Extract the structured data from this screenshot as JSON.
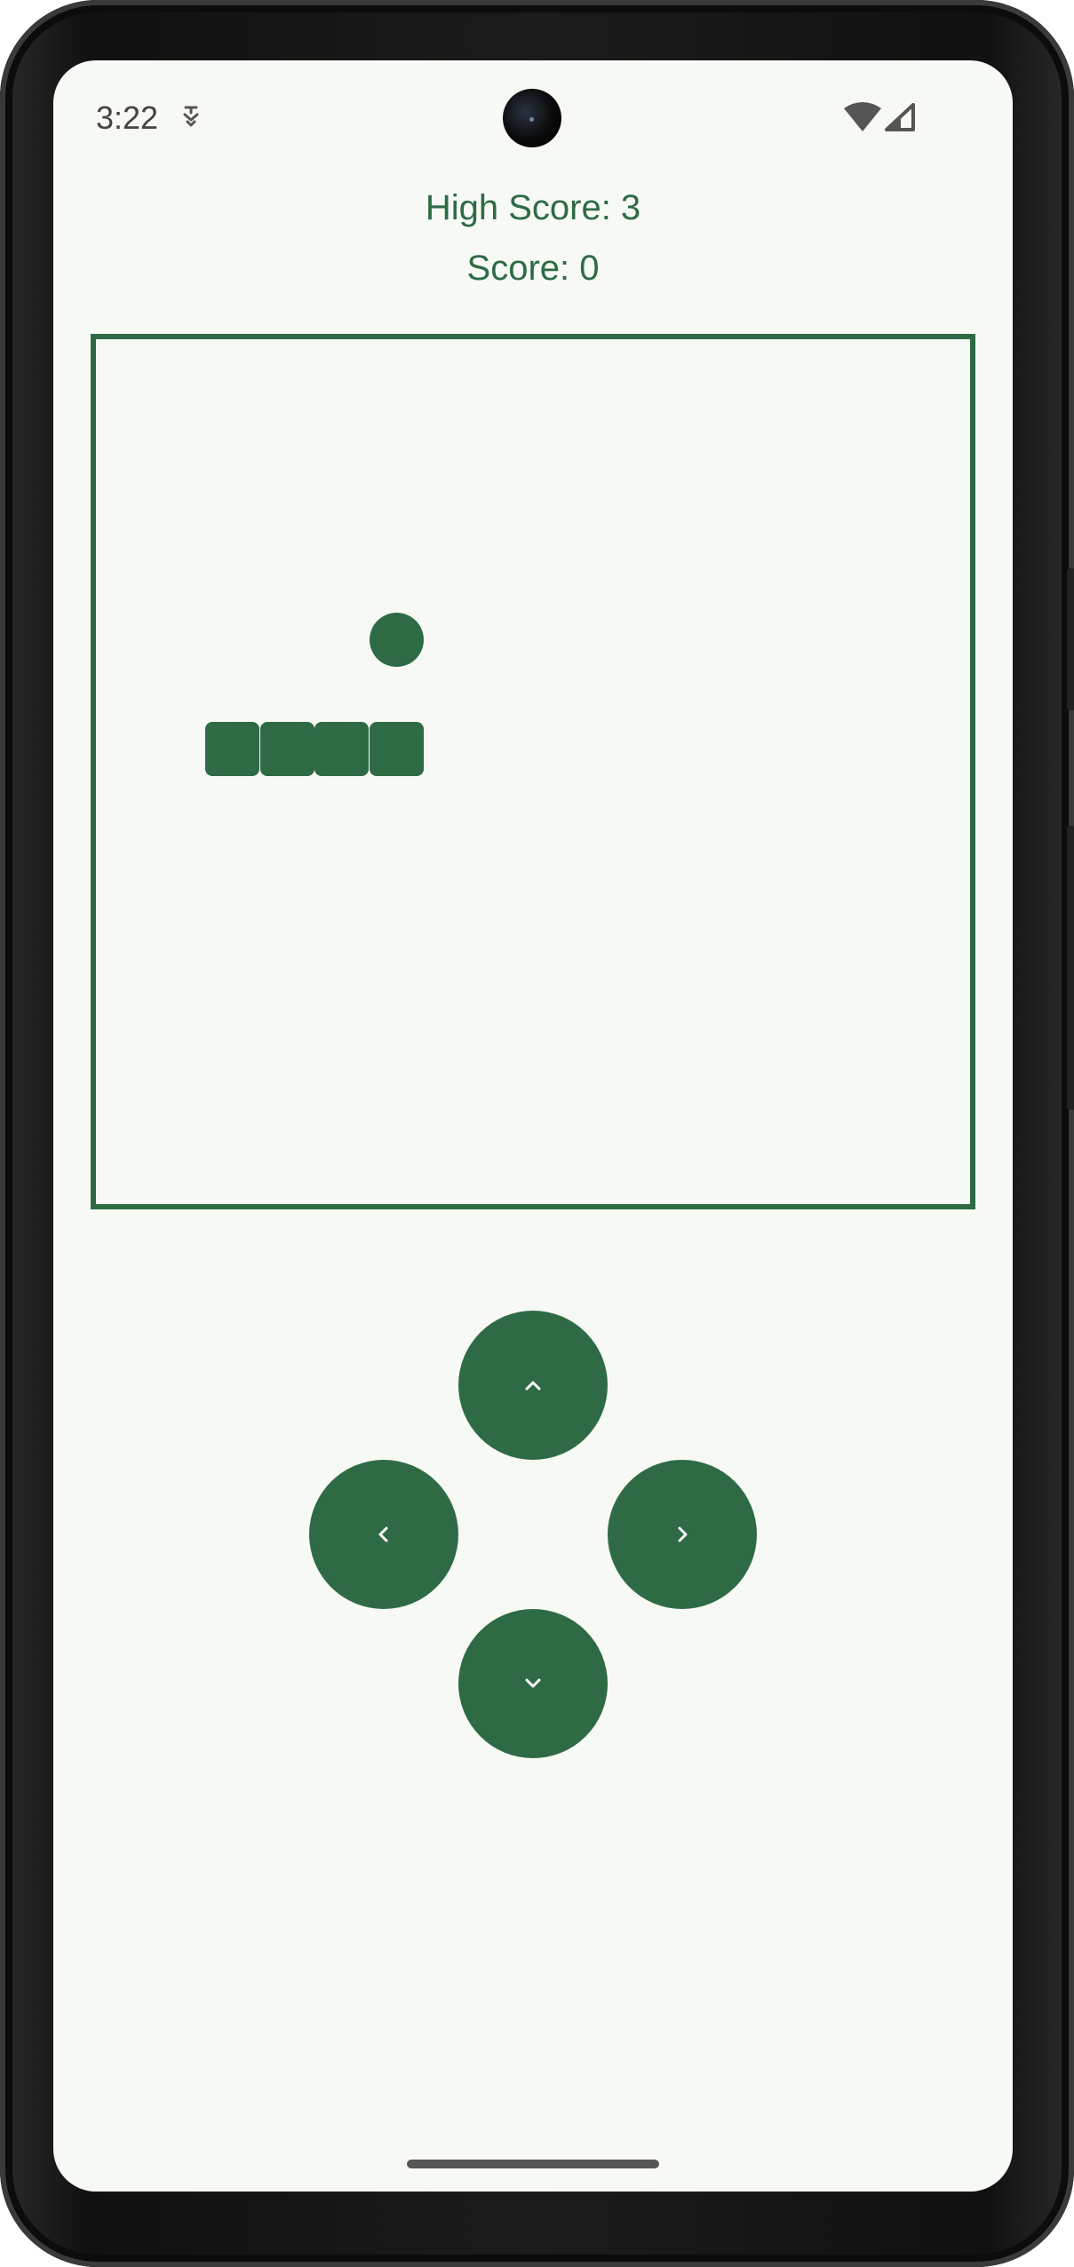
{
  "status_bar": {
    "time": "3:22",
    "icons": [
      "sim-card-icon",
      "wifi-icon",
      "cellular-signal-icon"
    ]
  },
  "scores": {
    "high_score_label": "High Score: 3",
    "score_label": "Score: 0"
  },
  "game_board": {
    "grid_cells": 16,
    "snake_segments": [
      [
        2,
        7
      ],
      [
        3,
        7
      ],
      [
        4,
        7
      ],
      [
        5,
        7
      ]
    ],
    "food": [
      5,
      5
    ]
  },
  "controls": {
    "up": {
      "icon": "chevron-up-icon"
    },
    "left": {
      "icon": "chevron-left-icon"
    },
    "right": {
      "icon": "chevron-right-icon"
    },
    "down": {
      "icon": "chevron-down-icon"
    }
  },
  "colors": {
    "primary": "#2e6b45",
    "background": "#f7f9f4",
    "button_icon": "#ffffff"
  }
}
